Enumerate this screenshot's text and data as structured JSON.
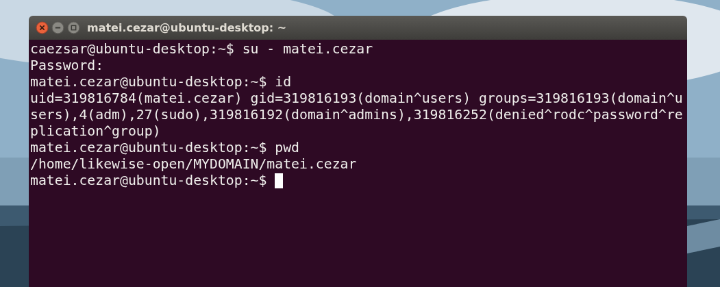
{
  "window": {
    "title": "matei.cezar@ubuntu-desktop: ~"
  },
  "terminal": {
    "lines": [
      {
        "text": "caezsar@ubuntu-desktop:~$ su - matei.cezar",
        "cursor": false
      },
      {
        "text": "Password:",
        "cursor": false
      },
      {
        "text": "matei.cezar@ubuntu-desktop:~$ id",
        "cursor": false
      },
      {
        "text": "uid=319816784(matei.cezar) gid=319816193(domain^users) groups=319816193(domain^u",
        "cursor": false
      },
      {
        "text": "sers),4(adm),27(sudo),319816192(domain^admins),319816252(denied^rodc^password^re",
        "cursor": false
      },
      {
        "text": "plication^group)",
        "cursor": false
      },
      {
        "text": "matei.cezar@ubuntu-desktop:~$ pwd",
        "cursor": false
      },
      {
        "text": "/home/likewise-open/MYDOMAIN/matei.cezar",
        "cursor": false
      },
      {
        "text": "matei.cezar@ubuntu-desktop:~$ ",
        "cursor": true
      }
    ]
  }
}
